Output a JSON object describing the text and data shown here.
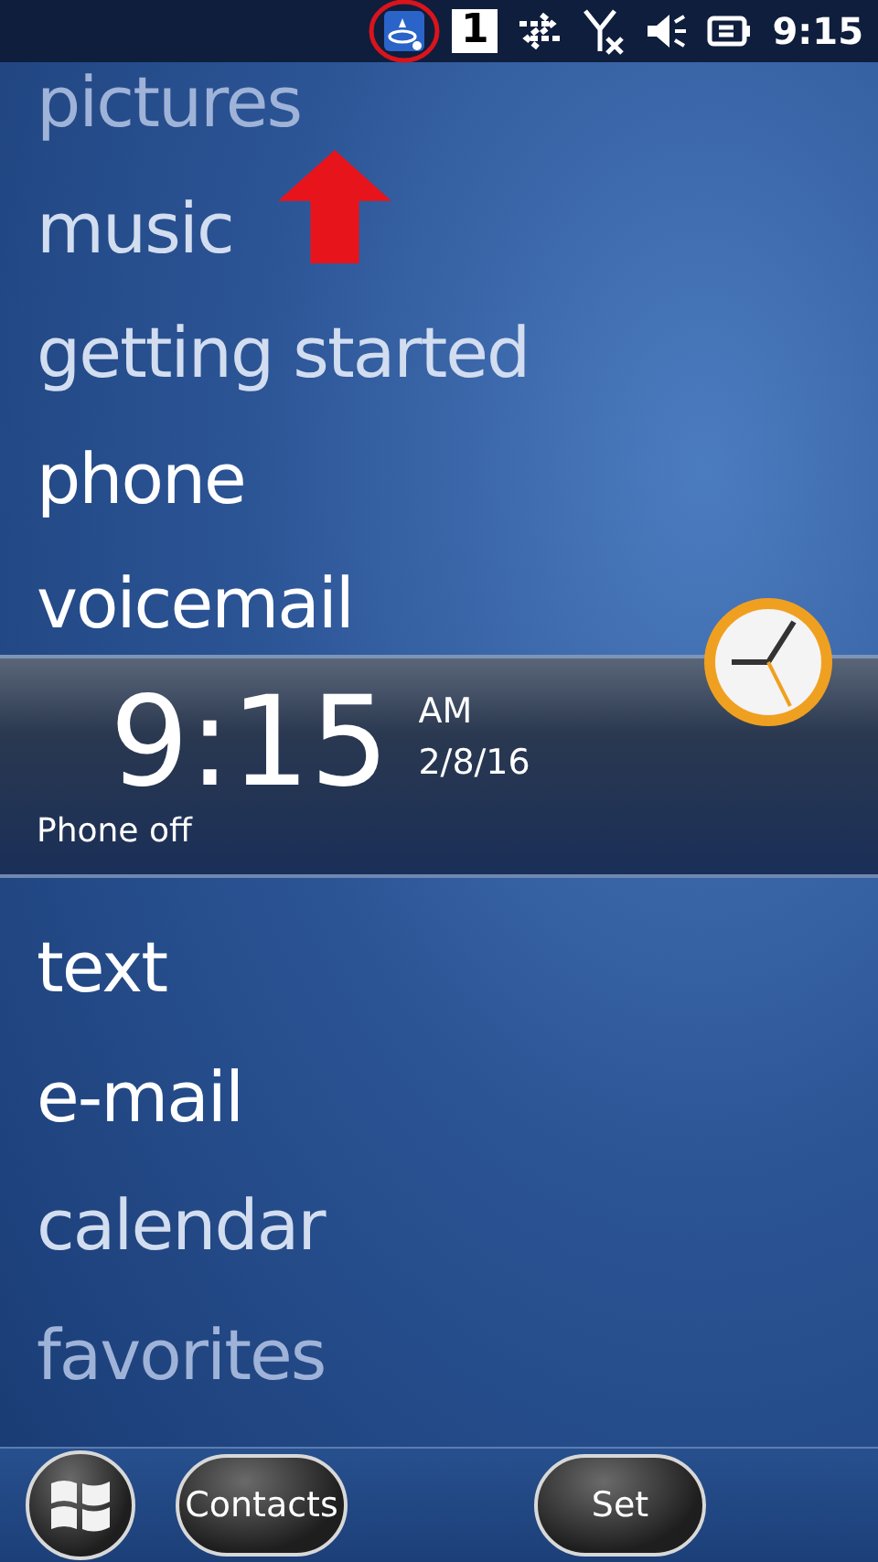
{
  "status_bar": {
    "sim": "1",
    "time": "9:15"
  },
  "upper_menu": [
    {
      "label": "pictures",
      "kind": "faint"
    },
    {
      "label": "music",
      "kind": "dim"
    },
    {
      "label": "getting started",
      "kind": "dim"
    },
    {
      "label": "phone",
      "kind": "bright"
    },
    {
      "label": "voicemail",
      "kind": "bright"
    }
  ],
  "clock_panel": {
    "time": "9:15",
    "meridiem": "AM",
    "date": "2/8/16",
    "status": "Phone off"
  },
  "lower_menu": [
    {
      "label": "text",
      "kind": "bright"
    },
    {
      "label": "e-mail",
      "kind": "bright"
    },
    {
      "label": "calendar",
      "kind": "dim"
    },
    {
      "label": "favorites",
      "kind": "faint"
    }
  ],
  "softkeys": {
    "left": "Contacts",
    "right": "Set"
  }
}
